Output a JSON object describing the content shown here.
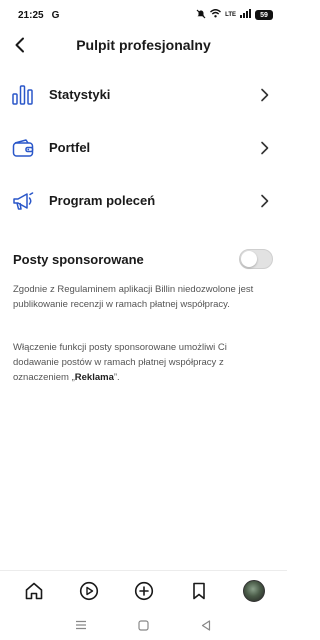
{
  "status_bar": {
    "time": "21:25",
    "app_letter": "G",
    "network_label": "LTE",
    "battery": "59"
  },
  "header": {
    "title": "Pulpit profesjonalny"
  },
  "menu": {
    "items": [
      {
        "label": "Statystyki",
        "icon": "bar-chart-icon"
      },
      {
        "label": "Portfel",
        "icon": "wallet-icon"
      },
      {
        "label": "Program poleceń",
        "icon": "megaphone-icon"
      }
    ]
  },
  "sponsored": {
    "label": "Posty sponsorowane",
    "enabled": false
  },
  "info": {
    "paragraph1": "Zgodnie z Regulaminem aplikacji Billin niedozwolone jest publikowanie recenzji w ramach płatnej współpracy.",
    "paragraph2_prefix": "Włączenie funkcji posty sponsorowane umożliwi Ci dodawanie postów w ramach płatnej współpracy z oznaczeniem „",
    "paragraph2_bold": "Reklama",
    "paragraph2_suffix": "”."
  },
  "bottom_nav": [
    "home-icon",
    "play-icon",
    "add-icon",
    "bookmark-icon",
    "profile-avatar"
  ],
  "colors": {
    "text": "#1a1a1a",
    "accent": "#2a57c9",
    "toggle_off": "#e2e2e2"
  }
}
